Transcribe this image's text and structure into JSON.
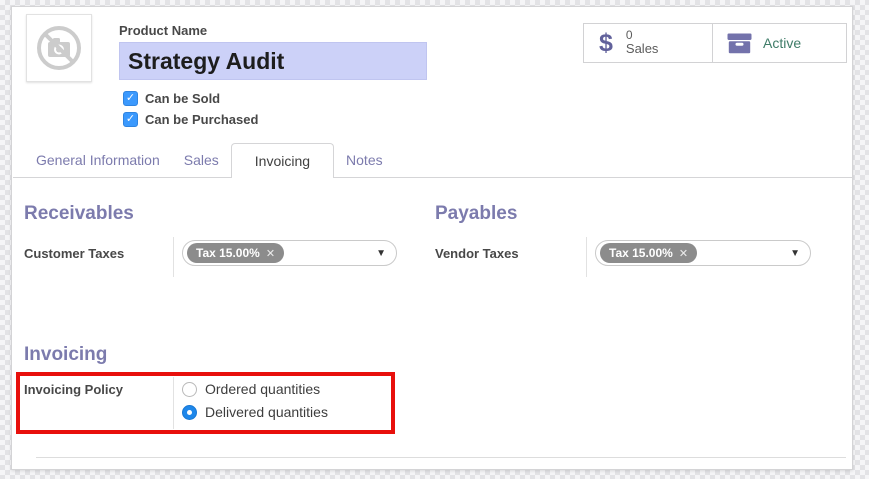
{
  "product": {
    "image_placeholder": "no-camera-icon",
    "name_label": "Product Name",
    "name_value": "Strategy Audit",
    "checkboxes": [
      {
        "label": "Can be Sold",
        "checked": true
      },
      {
        "label": "Can be Purchased",
        "checked": true
      }
    ]
  },
  "stat_buttons": {
    "sales": {
      "icon": "dollar-icon",
      "count": "0",
      "label": "Sales"
    },
    "active": {
      "icon": "archive-box-icon",
      "label": "Active"
    }
  },
  "tabs": [
    {
      "label": "General Information",
      "active": false
    },
    {
      "label": "Sales",
      "active": false
    },
    {
      "label": "Invoicing",
      "active": true
    },
    {
      "label": "Notes",
      "active": false
    }
  ],
  "sections": {
    "receivables": {
      "title": "Receivables",
      "field_label": "Customer Taxes",
      "tag": "Tax 15.00%",
      "tag_remove": "✕",
      "caret": "▼"
    },
    "payables": {
      "title": "Payables",
      "field_label": "Vendor Taxes",
      "tag": "Tax 15.00%",
      "tag_remove": "✕",
      "caret": "▼"
    },
    "invoicing": {
      "title": "Invoicing",
      "field_label": "Invoicing Policy",
      "options": [
        {
          "label": "Ordered quantities",
          "selected": false
        },
        {
          "label": "Delivered quantities",
          "selected": true
        }
      ]
    }
  },
  "checkmark": "✓",
  "colors": {
    "accent_purple": "#7c7bad",
    "name_highlight": "#ccd1f8",
    "checkbox_blue": "#3b99fd",
    "radio_blue": "#1e87ea",
    "tag_gray": "#8c8c8c",
    "active_green": "#3f7c68",
    "annotation_red": "#e8100c",
    "icon_purple": "#7372ab"
  }
}
